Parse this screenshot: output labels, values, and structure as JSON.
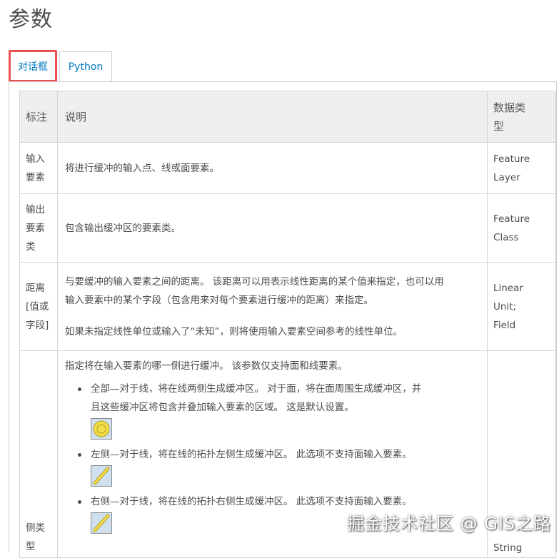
{
  "page": {
    "title": "参数"
  },
  "tabs": [
    {
      "label": "对话框",
      "active": true
    },
    {
      "label": "Python",
      "active": false
    }
  ],
  "table": {
    "headers": {
      "label": "标注",
      "description": "说明",
      "data_type_line1": "数据类",
      "data_type_line2": "型"
    },
    "rows": [
      {
        "label_lines": [
          "输入",
          "要素"
        ],
        "description": "将进行缓冲的输入点、线或面要素。",
        "type_lines": [
          "Feature",
          "Layer"
        ]
      },
      {
        "label_lines": [
          "输出",
          "要素",
          "类"
        ],
        "description": "包含输出缓冲区的要素类。",
        "type_lines": [
          "Feature",
          "Class"
        ]
      },
      {
        "label_lines": [
          "距离",
          "[值或",
          "字段]"
        ],
        "description_lines": [
          "与要缓冲的输入要素之间的距离。 该距离可以用表示线性距离的某个值来指定，也可以用",
          "输入要素中的某个字段（包含用来对每个要素进行缓冲的距离）来指定。",
          "如果未指定线性单位或输入了“未知”，则将使用输入要素空间参考的线性单位。"
        ],
        "type_lines": [
          "Linear",
          "Unit;",
          "Field"
        ]
      },
      {
        "label_lines": [
          "侧类",
          "型"
        ],
        "intro": "指定将在输入要素的哪一侧进行缓冲。 该参数仅支持面和线要素。",
        "options": [
          {
            "lines": [
              "全部—对于线，将在线两侧生成缓冲区。 对于面，将在面周围生成缓冲区，并",
              "且这些缓冲区将包含并叠加输入要素的区域。 这是默认设置。"
            ],
            "icon": "full-buffer-icon"
          },
          {
            "lines": [
              "左侧—对于线，将在线的拓扑左侧生成缓冲区。 此选项不支持面输入要素。"
            ],
            "icon": "left-buffer-icon"
          },
          {
            "lines": [
              "右侧—对于线，将在线的拓扑右侧生成缓冲区。 此选项不支持面输入要素。"
            ],
            "icon": "right-buffer-icon"
          }
        ],
        "type_lines": [
          "String"
        ]
      }
    ]
  },
  "watermark": "掘金技术社区 @ GIS之路",
  "colors": {
    "accent": "#0079c1",
    "highlight_border": "#e8514f",
    "header_bg": "#efefef",
    "symbol_fill": "#f2de4b"
  }
}
